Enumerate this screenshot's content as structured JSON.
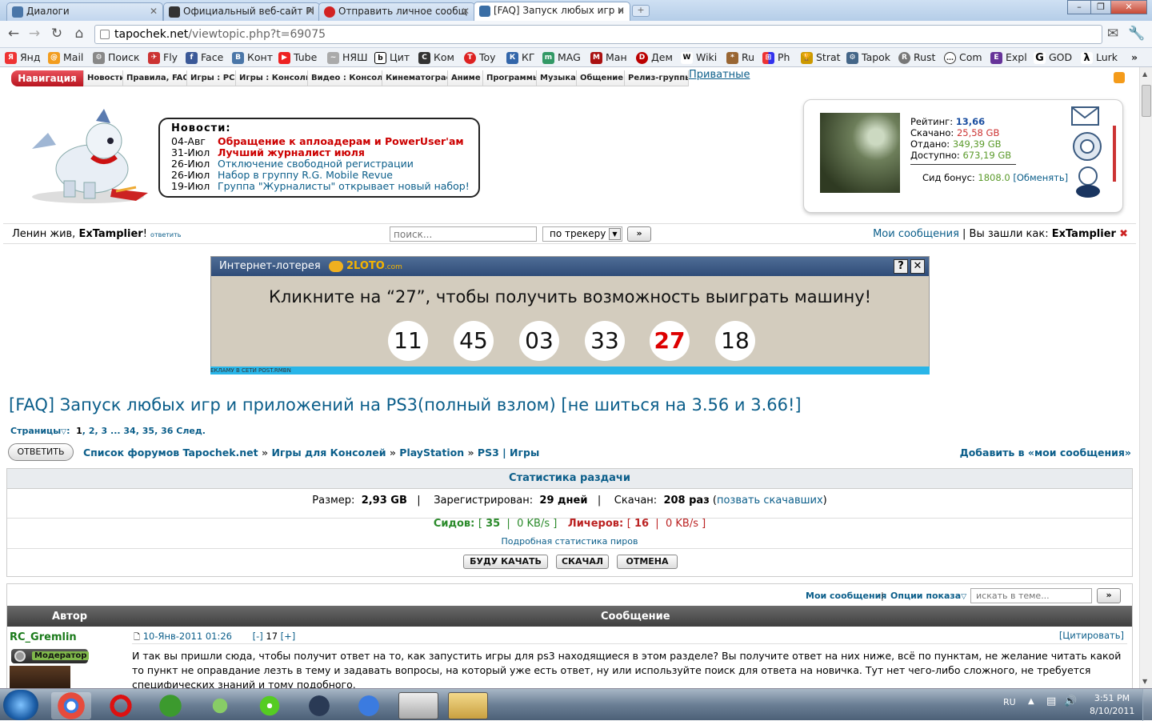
{
  "browser": {
    "tabs": [
      {
        "label": "Диалоги",
        "color": "#4a76a8"
      },
      {
        "label": "Официальный веб-сайт Pl",
        "color": "#333333"
      },
      {
        "label": "Отправить личное сообщ",
        "color": "#d22222"
      },
      {
        "label": "[FAQ] Запуск любых игр и",
        "color": "#3a6ea5"
      }
    ],
    "url_domain": "tapochek.net",
    "url_path": "/viewtopic.php?t=69075",
    "window_buttons": {
      "minimize": "–",
      "maximize": "❐",
      "close": "✕"
    },
    "bookmarks": [
      "Янд",
      "Mail",
      "Поиск",
      "Fly",
      "Face",
      "Конт",
      "Tube",
      "НЯШ",
      "Цит",
      "Ком",
      "Toy",
      "КГ",
      "MAG",
      "Ман",
      "Дем",
      "Wiki",
      "Ru",
      "Ph",
      "Strat",
      "Tapok",
      "Rust",
      "Com",
      "Expl",
      "GOD",
      "Lurk"
    ],
    "overflow": "»"
  },
  "nav": {
    "label": "Навигация",
    "items": [
      "Новости",
      "Правила, FAQ",
      "Игры : PC",
      "Игры : Консоли",
      "Видео : Консоли",
      "Кинематограф",
      "Аниме",
      "Программы",
      "Музыка",
      "Общение",
      "Релиз-группы"
    ],
    "private": "Приватные"
  },
  "news": {
    "heading": "Новости:",
    "items": [
      {
        "date": "04-Авг",
        "text": "Обращение к аплоадерам и PowerUser'ам",
        "style": "red"
      },
      {
        "date": "31-Июл",
        "text": "Лучший журналист июля",
        "style": "red"
      },
      {
        "date": "26-Июл",
        "text": "Отключение свободной регистрации",
        "style": "blue"
      },
      {
        "date": "26-Июл",
        "text": "Набор в группу R.G. Mobile Revue",
        "style": "blue"
      },
      {
        "date": "19-Июл",
        "text": "Группа \"Журналисты\" открывает новый набор!",
        "style": "blue"
      }
    ]
  },
  "user": {
    "rating_label": "Рейтинг:",
    "rating": "13,66",
    "downloaded_label": "Скачано:",
    "downloaded": "25,58 GB",
    "uploaded_label": "Отдано:",
    "uploaded": "349,39 GB",
    "available_label": "Доступно:",
    "available": "673,19 GB",
    "bonus_label": "Сид бонус:",
    "bonus": "1808.0",
    "exchange": "[Обменять]"
  },
  "searchbar": {
    "greeting": "Ленин жив, ",
    "username": "ExTamplier",
    "excl": "!",
    "reply": "ответить",
    "placeholder": "поиск...",
    "scope": "по трекеру",
    "go": "»",
    "my_messages": "Мои сообщения",
    "logged_as": " | Вы зашли как: ",
    "logout": "✖"
  },
  "ad": {
    "bar_title": "Интернет-лотерея",
    "brand": "2LOTO",
    "brand_tld": ".com",
    "help": "?",
    "close": "✕",
    "headline": "Кликните на “27”, чтобы получить возможность выиграть машину!",
    "numbers": [
      "11",
      "45",
      "03",
      "33",
      "27",
      "18"
    ],
    "footer": "ЕКЛАМУ В СЕТИ POST.RMBN"
  },
  "topic": {
    "title": "[FAQ] Запуск любых игр и приложений на PS3(полный взлом) [не шиться на 3.56 и 3.66!]",
    "pages_label": "Страницы",
    "pages": [
      "1",
      ",",
      "2",
      ",",
      "3",
      "...",
      "34",
      ",",
      "35",
      ",",
      "36"
    ],
    "next": "След."
  },
  "breadcrumbs": {
    "reply_button": "ОТВЕТИТЬ",
    "items": [
      "Список форумов Tapochek.net",
      "»",
      "Игры для Консолей",
      "»",
      "PlayStation",
      "»",
      "PS3 | Игры"
    ],
    "add_to_my": "Добавить в «мои сообщения»"
  },
  "stats": {
    "title": "Статистика раздачи",
    "size_label": "Размер:",
    "size": "2,93 GB",
    "registered_label": "Зарегистрирован:",
    "registered": "29 дней",
    "downloaded_label": "Скачан:",
    "downloaded": "208 раз",
    "call_downloaders": "позвать скачавших",
    "seeds_label": "Сидов:",
    "seeds": "35",
    "seed_speed": "0 KB/s",
    "leech_label": "Личеров:",
    "leeches": "16",
    "leech_speed": "0 KB/s",
    "peer_stats": "Подробная статистика пиров",
    "btn_will": "БУДУ КАЧАТЬ",
    "btn_done": "СКАЧАЛ",
    "btn_cancel": "ОТМЕНА"
  },
  "posts": {
    "my_messages": "Мои сообщения",
    "options": "Опции показа",
    "search_placeholder": "искать в теме...",
    "go": "»",
    "col_author": "Автор",
    "col_message": "Сообщение",
    "author": "RC_Gremlin",
    "role": "Модератор",
    "date": "10-Янв-2011 01:26",
    "rep_minus": "[-]",
    "rep": "17",
    "rep_plus": "[+]",
    "quote": "[Цитировать]",
    "body": "И так вы пришли сюда, чтобы получит ответ на то, как запустить игры для ps3 находящиеся в этом разделе? Вы получите ответ на них ниже, всё по пунктам, не желание читать какой то пункт не оправдание лезть в тему и задавать вопросы, на который уже есть ответ, ну или используйте поиск для ответа на новичка. Тут нет чего-либо сложного, не требуется специфических знаний и тому подобного."
  },
  "taskbar": {
    "lang": "RU",
    "time": "3:51 PM",
    "date": "8/10/2011"
  }
}
